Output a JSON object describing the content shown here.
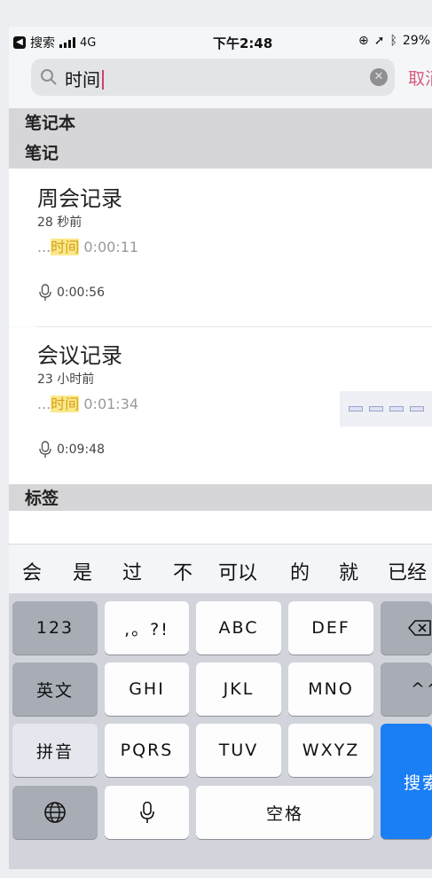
{
  "status_bar": {
    "back_label": "搜索",
    "network": "4G",
    "time": "下午2:48",
    "battery": "29%"
  },
  "search": {
    "query": "时间",
    "cancel_label": "取消"
  },
  "sections": {
    "notebooks": "笔记本",
    "notes": "笔记",
    "tags": "标签"
  },
  "notes": [
    {
      "title": "周会记录",
      "time_ago": "28 秒前",
      "snippet_prefix": "...",
      "snippet_match": "时间",
      "snippet_rest": " 0:00:11",
      "duration": "0:00:56"
    },
    {
      "title": "会议记录",
      "time_ago": "23 小时前",
      "snippet_prefix": "...",
      "snippet_match": "时间",
      "snippet_rest": " 0:01:34",
      "duration": "0:09:48"
    }
  ],
  "candidates": [
    "会",
    "是",
    "过",
    "不",
    "可以",
    "的",
    "就",
    "已经"
  ],
  "keyboard": {
    "num_key": "123",
    "punct_key": ",。?!",
    "abc": "ABC",
    "def": "DEF",
    "english": "英文",
    "ghi": "GHI",
    "jkl": "JKL",
    "mno": "MNO",
    "caret_key": "^^",
    "pinyin": "拼音",
    "pqrs": "PQRS",
    "tuv": "TUV",
    "wxyz": "WXYZ",
    "search_key": "搜索",
    "space": "空格"
  },
  "colors": {
    "accent": "#d95b7d",
    "highlight": "#fbe88a",
    "search_key": "#1a7ef5"
  },
  "icons": [
    "back-arrow-icon",
    "signal-icon",
    "location-icon",
    "bluetooth-icon",
    "search-icon",
    "clear-icon",
    "microphone-icon",
    "globe-icon",
    "delete-icon"
  ]
}
